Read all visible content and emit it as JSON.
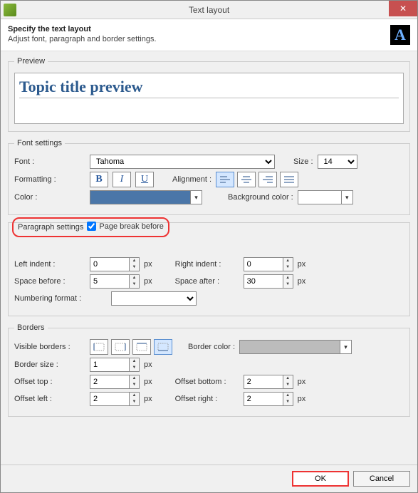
{
  "window": {
    "title": "Text layout",
    "close_glyph": "✕"
  },
  "header": {
    "title": "Specify the text layout",
    "subtitle": "Adjust font, paragraph and border settings.",
    "icon_letter": "A"
  },
  "preview": {
    "legend": "Preview",
    "text": "Topic title preview"
  },
  "font_settings": {
    "legend": "Font settings",
    "font_label": "Font :",
    "font_value": "Tahoma",
    "size_label": "Size :",
    "size_value": "14",
    "formatting_label": "Formatting :",
    "bold": "B",
    "italic": "I",
    "underline": "U",
    "alignment_label": "Alignment :",
    "alignment_selected": 0,
    "color_label": "Color :",
    "color_value": "#4a76a8",
    "bgcolor_label": "Background color :",
    "bgcolor_value": "#ffffff"
  },
  "paragraph": {
    "legend": "Paragraph settings",
    "page_break_label": "Page break before",
    "page_break_checked": true,
    "left_indent_label": "Left indent :",
    "left_indent_value": "0",
    "right_indent_label": "Right indent :",
    "right_indent_value": "0",
    "space_before_label": "Space before :",
    "space_before_value": "5",
    "space_after_label": "Space after :",
    "space_after_value": "30",
    "numbering_label": "Numbering format :",
    "numbering_value": "",
    "unit": "px"
  },
  "borders": {
    "legend": "Borders",
    "visible_label": "Visible borders :",
    "border_selected": 3,
    "color_label": "Border color :",
    "color_value": "#bcbcbc",
    "size_label": "Border size :",
    "size_value": "1",
    "offset_top_label": "Offset top :",
    "offset_top_value": "2",
    "offset_bottom_label": "Offset bottom :",
    "offset_bottom_value": "2",
    "offset_left_label": "Offset left :",
    "offset_left_value": "2",
    "offset_right_label": "Offset right :",
    "offset_right_value": "2",
    "unit": "px"
  },
  "footer": {
    "ok": "OK",
    "cancel": "Cancel"
  }
}
